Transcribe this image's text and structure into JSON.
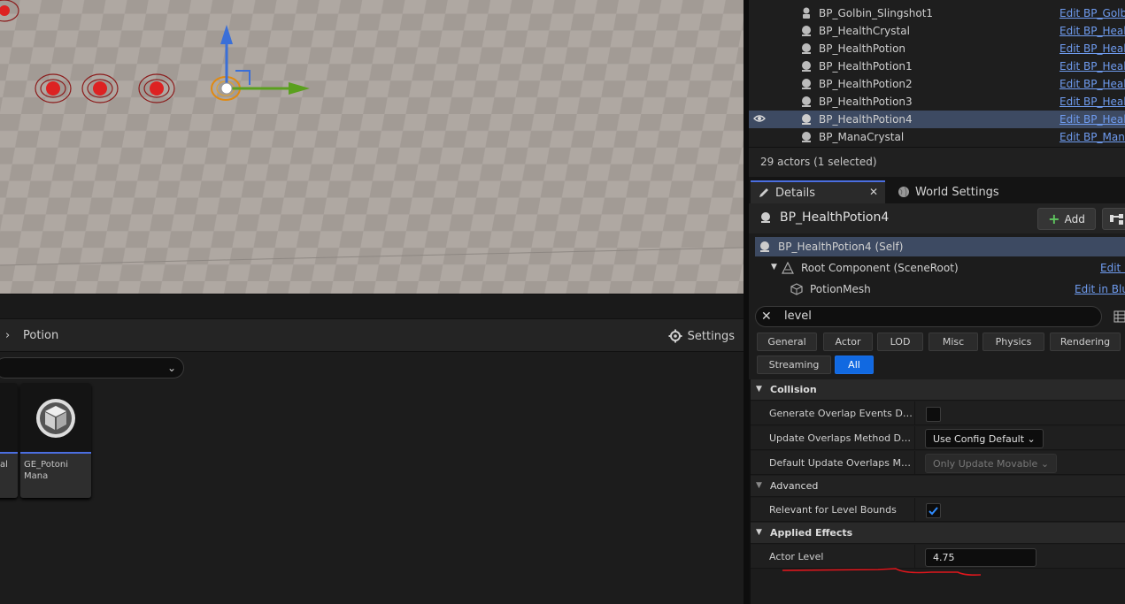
{
  "viewport": {},
  "content_browser": {
    "path_label": "Potion",
    "settings_label": "Settings",
    "assets": [
      {
        "label": "al"
      },
      {
        "label": "GE_Potoni Mana"
      }
    ]
  },
  "outliner": {
    "rows": [
      {
        "name": "BP_Golbin_Slingshot1",
        "edit": "Edit BP_Golbin_Slingshot",
        "icon": "skeletal-actor-icon",
        "selected": false
      },
      {
        "name": "BP_HealthCrystal",
        "edit": "Edit BP_HealthCrystal",
        "icon": "actor-icon",
        "selected": false
      },
      {
        "name": "BP_HealthPotion",
        "edit": "Edit BP_HealthPotion",
        "icon": "actor-icon",
        "selected": false
      },
      {
        "name": "BP_HealthPotion1",
        "edit": "Edit BP_HealthPotion",
        "icon": "actor-icon",
        "selected": false
      },
      {
        "name": "BP_HealthPotion2",
        "edit": "Edit BP_HealthPotion",
        "icon": "actor-icon",
        "selected": false
      },
      {
        "name": "BP_HealthPotion3",
        "edit": "Edit BP_HealthPotion",
        "icon": "actor-icon",
        "selected": false
      },
      {
        "name": "BP_HealthPotion4",
        "edit": "Edit BP_HealthPotion",
        "icon": "actor-icon",
        "selected": true
      },
      {
        "name": "BP_ManaCrystal",
        "edit": "Edit BP_ManaCrystal",
        "icon": "actor-icon",
        "selected": false
      }
    ],
    "status": "29 actors (1 selected)"
  },
  "details": {
    "tabs": [
      {
        "label": "Details"
      },
      {
        "label": "World Settings"
      }
    ],
    "actor_name": "BP_HealthPotion4",
    "add_label": "Add",
    "components": [
      {
        "name": "BP_HealthPotion4 (Self)",
        "edit": ""
      },
      {
        "name": "Root Component (SceneRoot)",
        "edit": "Edit in Blueprint"
      },
      {
        "name": "PotionMesh",
        "edit": "Edit in Blueprint"
      }
    ],
    "search_value": "level",
    "filters": [
      "General",
      "Actor",
      "LOD",
      "Misc",
      "Physics",
      "Rendering",
      "Streaming",
      "All"
    ],
    "active_filter": "All",
    "categories": {
      "collision": "Collision",
      "advanced": "Advanced",
      "applied_effects": "Applied Effects"
    },
    "properties": {
      "generate_overlap": {
        "label": "Generate Overlap Events During Level Streaming",
        "checked": false
      },
      "update_overlaps": {
        "label": "Update Overlaps Method During Level Streaming",
        "value": "Use Config Default"
      },
      "default_update_overlaps": {
        "label": "Default Update Overlaps Method During Level Streaming",
        "value": "Only Update Movable"
      },
      "relevant_bounds": {
        "label": "Relevant for Level Bounds",
        "checked": true
      },
      "actor_level": {
        "label": "Actor Level",
        "value": "4.75"
      }
    }
  },
  "colors": {
    "accent": "#1169e1",
    "selection": "#3d4a62",
    "link": "#6f9cf0",
    "annotation": "#e0161c"
  }
}
